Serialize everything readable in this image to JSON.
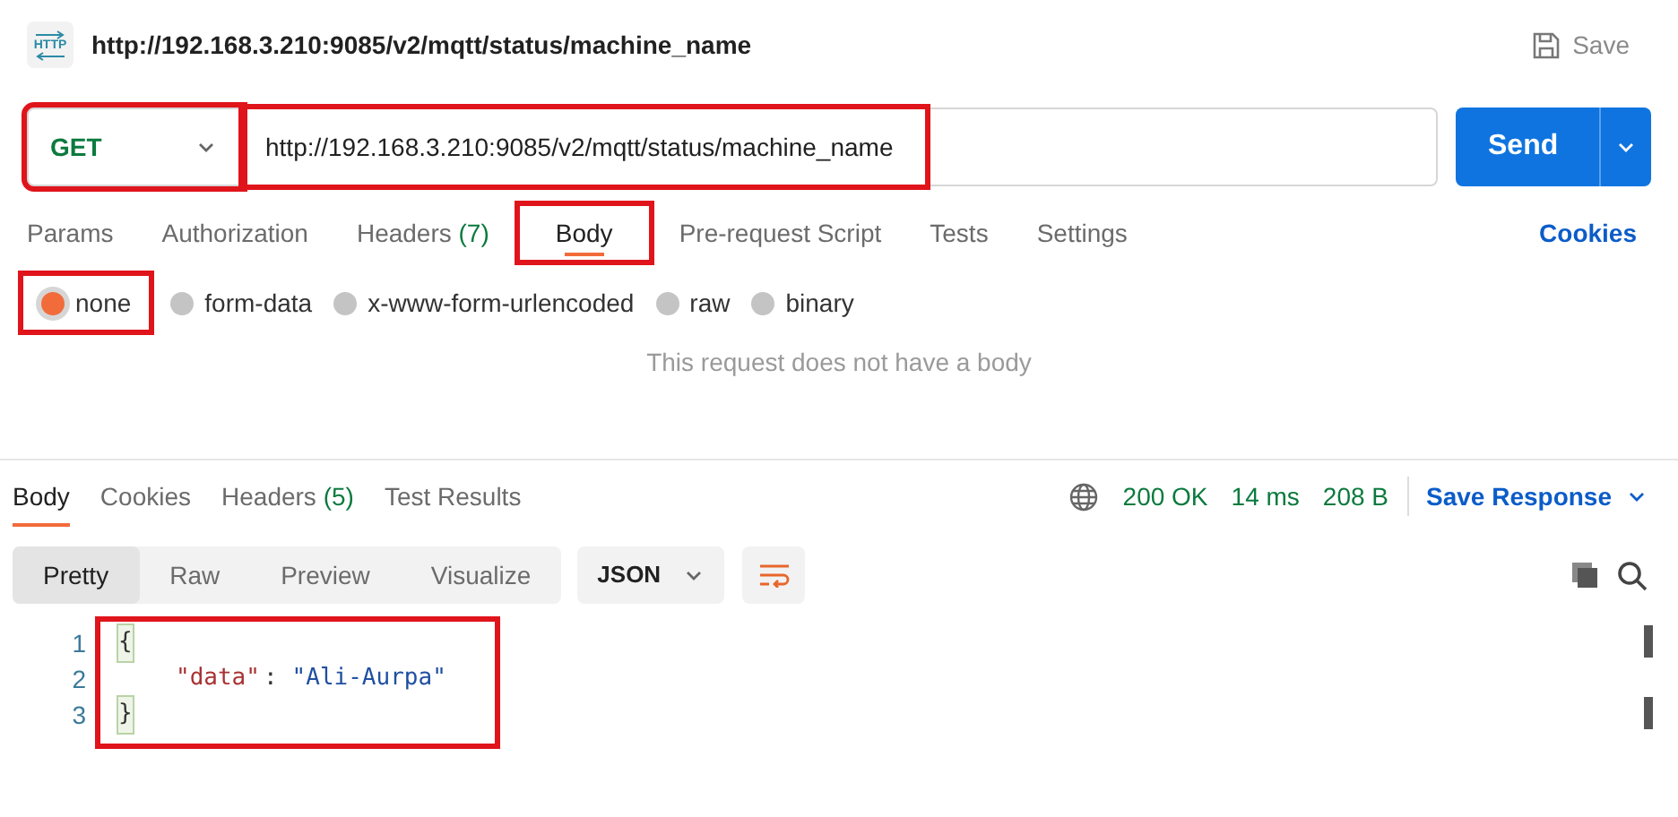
{
  "request_title": {
    "icon_label": "HTTP",
    "text": "http://192.168.3.210:9085/v2/mqtt/status/machine_name"
  },
  "save_button": "Save",
  "method": {
    "value": "GET",
    "highlighted": true
  },
  "url": {
    "value": "http://192.168.3.210:9085/v2/mqtt/status/machine_name",
    "highlighted": true
  },
  "send_button": "Send",
  "request_tabs": [
    {
      "label": "Params",
      "selected": false,
      "highlighted": false
    },
    {
      "label": "Authorization",
      "selected": false,
      "highlighted": false
    },
    {
      "label": "Headers",
      "count": "(7)",
      "selected": false,
      "highlighted": false
    },
    {
      "label": "Body",
      "selected": true,
      "highlighted": true
    },
    {
      "label": "Pre-request Script",
      "selected": false,
      "highlighted": false
    },
    {
      "label": "Tests",
      "selected": false,
      "highlighted": false
    },
    {
      "label": "Settings",
      "selected": false,
      "highlighted": false
    }
  ],
  "cookies_link": "Cookies",
  "body_types": [
    {
      "label": "none",
      "selected": true,
      "highlighted": true
    },
    {
      "label": "form-data",
      "selected": false,
      "highlighted": false
    },
    {
      "label": "x-www-form-urlencoded",
      "selected": false,
      "highlighted": false
    },
    {
      "label": "raw",
      "selected": false,
      "highlighted": false
    },
    {
      "label": "binary",
      "selected": false,
      "highlighted": false
    }
  ],
  "empty_body_message": "This request does not have a body",
  "response_tabs": [
    {
      "label": "Body",
      "selected": true
    },
    {
      "label": "Cookies",
      "selected": false
    },
    {
      "label": "Headers",
      "count": "(5)",
      "selected": false
    },
    {
      "label": "Test Results",
      "selected": false
    }
  ],
  "status": {
    "code": "200 OK",
    "time": "14 ms",
    "size": "208 B"
  },
  "save_response": "Save Response",
  "view_modes": [
    {
      "label": "Pretty",
      "selected": true
    },
    {
      "label": "Raw",
      "selected": false
    },
    {
      "label": "Preview",
      "selected": false
    },
    {
      "label": "Visualize",
      "selected": false
    }
  ],
  "format": "JSON",
  "code": {
    "highlighted": true,
    "lines": [
      {
        "number": "1",
        "indent": false,
        "tokens": [
          {
            "kind": "bracket",
            "text": "{"
          }
        ]
      },
      {
        "number": "2",
        "indent": true,
        "tokens": [
          {
            "kind": "key",
            "text": "\"data\""
          },
          {
            "kind": "punct",
            "text": ":"
          },
          {
            "kind": "string",
            "text": "\"Ali-Aurpa\""
          }
        ]
      },
      {
        "number": "3",
        "indent": false,
        "tokens": [
          {
            "kind": "bracket",
            "text": "}"
          }
        ]
      }
    ]
  }
}
